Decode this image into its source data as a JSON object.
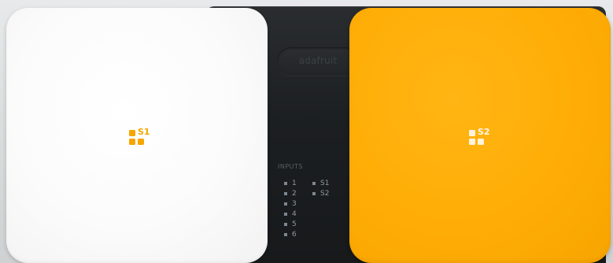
{
  "device": {
    "logo_text": "adafruit",
    "legend_title": "INPUTS",
    "legend_numbers": [
      "1",
      "2",
      "3",
      "4",
      "5",
      "6"
    ],
    "legend_sensors": [
      "S1",
      "S2"
    ]
  },
  "pads": {
    "left_label": "S1",
    "right_label": "S2"
  },
  "colors": {
    "accent_orange": "#ffad06",
    "white_pad": "#ffffff",
    "device_body": "#1c1f22"
  },
  "icons": {
    "sensor_mark": "three-square-grid-icon"
  }
}
